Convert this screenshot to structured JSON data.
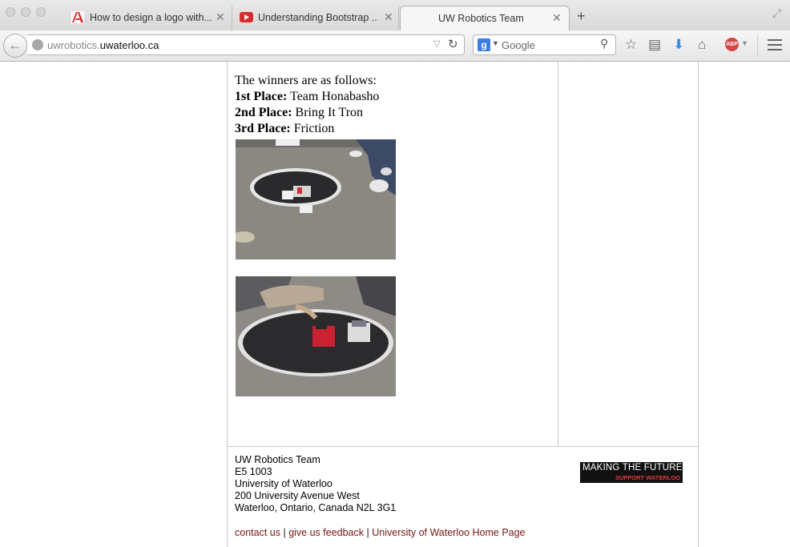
{
  "browser": {
    "tabs": [
      {
        "title": "How to design a logo with...",
        "icon": "adobe-icon"
      },
      {
        "title": "Understanding Bootstrap ...",
        "icon": "youtube-icon"
      },
      {
        "title": "UW Robotics Team",
        "icon": "none"
      }
    ],
    "url_prefix": "uwrobotics.",
    "url_host": "uwaterloo.ca",
    "search_placeholder": "Google"
  },
  "content": {
    "intro": "The winners are as follows:",
    "places": [
      {
        "label": "1st Place:",
        "team": "Team Honabasho"
      },
      {
        "label": "2nd Place:",
        "team": "Bring It Tron"
      },
      {
        "label": "3rd Place:",
        "team": "Friction"
      }
    ]
  },
  "footer": {
    "address": [
      "UW Robotics Team",
      "E5 1003",
      "University of Waterloo",
      "200 University Avenue West",
      "Waterloo, Ontario, Canada N2L 3G1"
    ],
    "links": [
      "contact us",
      "give us feedback",
      "University of Waterloo Home Page"
    ],
    "separator": "|",
    "badge_line1": "MAKING THE FUTURE",
    "badge_line2": "SUPPORT WATERLOO"
  },
  "colors": {
    "link": "#7a1414",
    "badge_bg": "#111111",
    "badge_accent": "#e23b3b"
  }
}
